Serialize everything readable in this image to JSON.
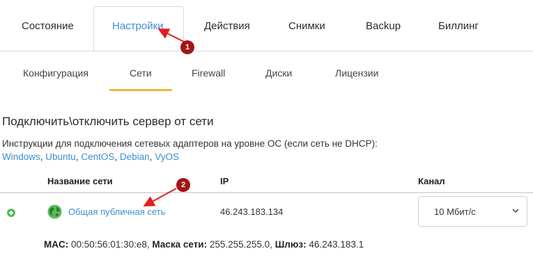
{
  "main_tabs": [
    {
      "label": "Состояние"
    },
    {
      "label": "Настройки"
    },
    {
      "label": "Действия"
    },
    {
      "label": "Снимки"
    },
    {
      "label": "Backup"
    },
    {
      "label": "Биллинг"
    }
  ],
  "sub_tabs": [
    {
      "label": "Конфигурация"
    },
    {
      "label": "Сети"
    },
    {
      "label": "Firewall"
    },
    {
      "label": "Диски"
    },
    {
      "label": "Лицензии"
    }
  ],
  "section": {
    "title": "Подключить\\отключить сервер от сети",
    "instructions": "Инструкции для подключения сетевых адаптеров на уровне ОС (если сеть не DHCP):",
    "os_links": [
      "Windows",
      "Ubuntu",
      "CentOS",
      "Debian",
      "VyOS"
    ],
    "separator": ", "
  },
  "table": {
    "headers": {
      "name": "Название сети",
      "ip": "IP",
      "channel": "Канал"
    },
    "rows": [
      {
        "name": "Общая публичная сеть",
        "ip": "46.243.183.134",
        "channel": "10 Мбит/с"
      }
    ]
  },
  "network_details": {
    "mac_label": "MAC:",
    "mac_value": "00:50:56:01:30:e8,",
    "mask_label": "Маска сети:",
    "mask_value": "255.255.255.0,",
    "gateway_label": "Шлюз:",
    "gateway_value": "46.243.183.1"
  },
  "annotations": [
    {
      "label": "1"
    },
    {
      "label": "2"
    }
  ],
  "colors": {
    "accent": "#3b8fd1",
    "underline": "#f5b335",
    "annotation": "#a31515",
    "add": "#5cb85c"
  }
}
